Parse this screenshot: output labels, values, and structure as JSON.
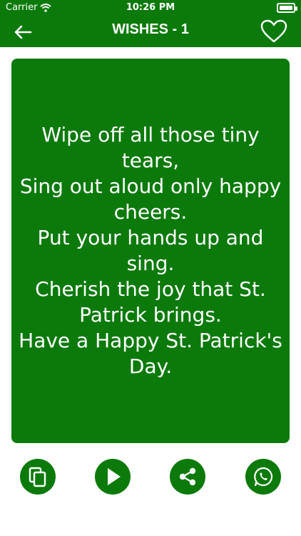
{
  "status_bar": {
    "carrier": "Carrier",
    "time": "10:26 PM",
    "wifi_icon": "wifi-icon",
    "battery_icon": "battery-icon"
  },
  "nav": {
    "title": "WISHES - 1",
    "back_icon": "arrow-left-icon",
    "favorite_icon": "heart-outline-icon"
  },
  "wish": {
    "text": "Wipe off all those tiny tears,\nSing out aloud only happy cheers.\nPut your hands up and sing.\nCherish the joy that St. Patrick brings.\nHave a Happy St. Patrick's Day."
  },
  "actions": [
    {
      "name": "copy",
      "icon": "copy-icon"
    },
    {
      "name": "play",
      "icon": "play-icon"
    },
    {
      "name": "share",
      "icon": "share-icon"
    },
    {
      "name": "whatsapp",
      "icon": "whatsapp-icon"
    }
  ],
  "colors": {
    "primary": "#0b7a0b",
    "text_on_primary": "#ffffff",
    "background": "#ffffff"
  }
}
